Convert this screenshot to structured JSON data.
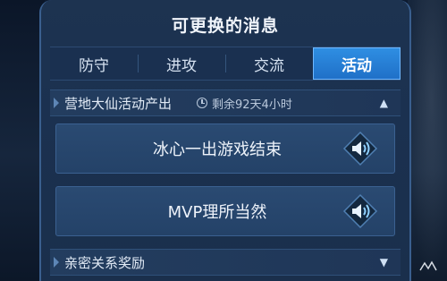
{
  "dialog": {
    "title": "可更换的消息"
  },
  "tabs": [
    {
      "label": "防守",
      "active": false
    },
    {
      "label": "进攻",
      "active": false
    },
    {
      "label": "交流",
      "active": false
    },
    {
      "label": "活动",
      "active": true
    }
  ],
  "sections": [
    {
      "title": "营地大仙活动产出",
      "timer": "剩余92天4小时",
      "expanded": true,
      "toggle_icon": "chevron-up-icon",
      "messages": [
        {
          "text": "冰心一出游戏结束",
          "icon": "speaker-icon"
        },
        {
          "text": "MVP理所当然",
          "icon": "speaker-icon"
        }
      ]
    },
    {
      "title": "亲密关系奖励",
      "expanded": false,
      "toggle_icon": "chevron-down-icon"
    }
  ],
  "colors": {
    "panel": "#1d3350",
    "active_tab": "#2f8fe3",
    "message_row": "#2a4a72",
    "speaker_icon": "#8fd0ff"
  }
}
